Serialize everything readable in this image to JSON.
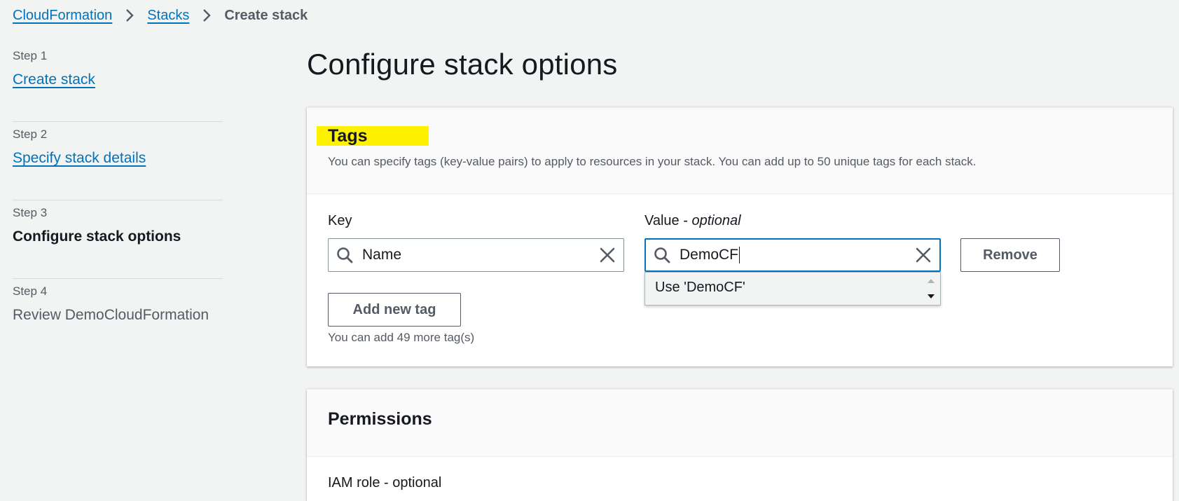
{
  "breadcrumb": {
    "items": [
      "CloudFormation",
      "Stacks"
    ],
    "current": "Create stack"
  },
  "steps": [
    {
      "num": "Step 1",
      "title": "Create stack",
      "state": "link"
    },
    {
      "num": "Step 2",
      "title": "Specify stack details",
      "state": "link"
    },
    {
      "num": "Step 3",
      "title": "Configure stack options",
      "state": "current"
    },
    {
      "num": "Step 4",
      "title": "Review DemoCloudFormation",
      "state": "disabled"
    }
  ],
  "page": {
    "title": "Configure stack options"
  },
  "tags": {
    "heading": "Tags",
    "description": "You can specify tags (key-value pairs) to apply to resources in your stack. You can add up to 50 unique tags for each stack.",
    "key_label": "Key",
    "value_label_main": "Value - ",
    "value_label_optional": "optional",
    "key_value": "Name",
    "value_value": "DemoCF",
    "remove_label": "Remove",
    "add_label": "Add new tag",
    "hint": "You can add 49 more tag(s)",
    "suggestion": "Use 'DemoCF'"
  },
  "permissions": {
    "heading": "Permissions",
    "iam_label": "IAM role - optional"
  },
  "colors": {
    "link": "#0073bb",
    "highlight": "#fff200",
    "focus": "#0073bb"
  }
}
